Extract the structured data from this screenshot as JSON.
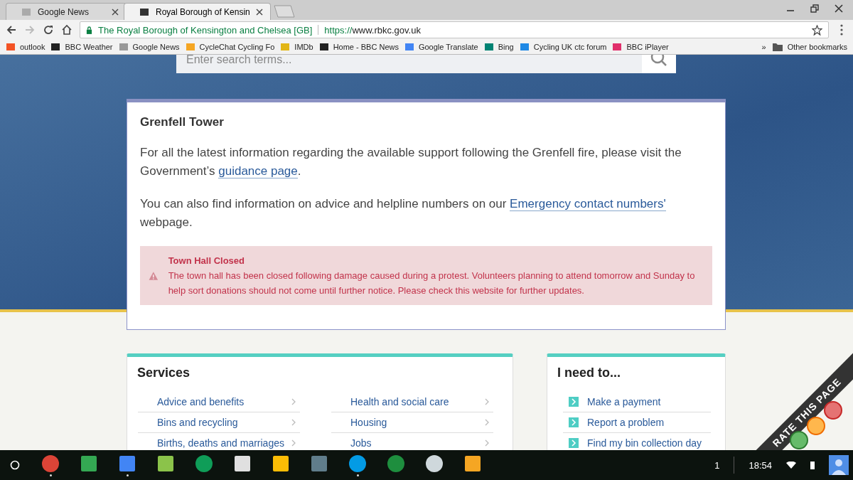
{
  "browser": {
    "tabs": [
      {
        "title": "Google News",
        "selected": false
      },
      {
        "title": "Royal Borough of Kensin",
        "selected": true
      }
    ],
    "address": {
      "site_name": "The Royal Borough of Kensington and Chelsea [GB]",
      "scheme": "https://",
      "host": "www.rbkc.gov.uk"
    },
    "bookmarks": [
      {
        "label": "outlook",
        "kind": "windows"
      },
      {
        "label": "BBC Weather",
        "kind": "bbc"
      },
      {
        "label": "Google News",
        "kind": "news"
      },
      {
        "label": "CycleChat Cycling Fo",
        "kind": "cc"
      },
      {
        "label": "IMDb",
        "kind": "imdb"
      },
      {
        "label": "Home - BBC News",
        "kind": "bbc"
      },
      {
        "label": "Google Translate",
        "kind": "translate"
      },
      {
        "label": "Bing",
        "kind": "bing"
      },
      {
        "label": "Cycling UK ctc forum",
        "kind": "ie"
      },
      {
        "label": "BBC iPlayer",
        "kind": "iplayer"
      }
    ],
    "overflow": "»",
    "other_bookmarks": "Other bookmarks"
  },
  "page": {
    "search": {
      "placeholder": "Enter search terms..."
    },
    "notice": {
      "title": "Grenfell Tower",
      "paragraphs": [
        [
          {
            "text": "For all the latest information regarding the available support following the Grenfell fire, please visit the Government’s ",
            "kind": "text"
          },
          {
            "text": "guidance page",
            "kind": "link"
          },
          {
            "text": ".",
            "kind": "text"
          }
        ],
        [
          {
            "text": "You can also find information on advice and helpline numbers on our ",
            "kind": "text"
          },
          {
            "text": "Emergency contact numbers'",
            "kind": "link"
          },
          {
            "text": " webpage.",
            "kind": "text"
          }
        ]
      ],
      "alert": {
        "title": "Town Hall Closed",
        "body": "The town hall has been closed following damage caused during a protest. Volunteers planning to attend tomorrow and Sunday to help sort donations should not come until further notice. Please check this website for further updates."
      }
    },
    "services": {
      "title": "Services",
      "columns": [
        [
          "Advice and benefits",
          "Bins and recycling",
          "Births, deaths and marriages"
        ],
        [
          "Health and social care",
          "Housing",
          "Jobs"
        ]
      ]
    },
    "i_need_to": {
      "title": "I need to...",
      "items": [
        "Make a payment",
        "Report a problem",
        "Find my bin collection day"
      ]
    },
    "rate": {
      "label": "RATE THIS PAGE"
    }
  },
  "shelf": {
    "apps": [
      {
        "kind": "chrome",
        "running": true
      },
      {
        "kind": "maps",
        "running": false
      },
      {
        "kind": "docs",
        "running": true
      },
      {
        "kind": "help",
        "running": false
      },
      {
        "kind": "hangouts",
        "running": false
      },
      {
        "kind": "gmail",
        "running": false
      },
      {
        "kind": "drive",
        "running": false
      },
      {
        "kind": "calculator",
        "running": false
      },
      {
        "kind": "files",
        "running": true
      },
      {
        "kind": "gear",
        "running": false
      },
      {
        "kind": "compass",
        "running": false
      },
      {
        "kind": "c",
        "running": false
      }
    ],
    "notifications": "1",
    "time": "18:54"
  }
}
